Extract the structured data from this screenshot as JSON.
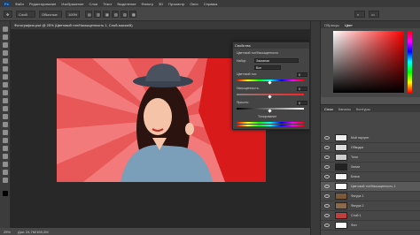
{
  "menubar": {
    "items": [
      "Файл",
      "Редактирование",
      "Изображение",
      "Слои",
      "Текст",
      "Выделение",
      "Фильтр",
      "3D",
      "Просмотр",
      "Окно",
      "Справка"
    ]
  },
  "options": {
    "select_label": "Слой",
    "mode_label": "Обычные",
    "mode_value": "100%"
  },
  "document": {
    "tab_title": "Фотография.psd @ 25% (Цветовой тон/Насыщенность 1, Слой-маска/8)",
    "zoom": "25%",
    "status": "Док: 24,7M/165,2M"
  },
  "dialog": {
    "title": "Свойства",
    "subtitle": "Цветовой тон/Насыщенность",
    "preset_label": "Набор:",
    "preset_value": "Заказная",
    "channel_value": "Все",
    "hue_label": "Цветовой тон:",
    "hue_value": "0",
    "sat_label": "Насыщенность:",
    "sat_value": "0",
    "light_label": "Яркость:",
    "light_value": "0",
    "tonirovanie": "Тонирование"
  },
  "color_panel": {
    "tabs": [
      "Образцы",
      "Цвет"
    ],
    "accent": "#ff0000"
  },
  "layers_panel": {
    "tabs": [
      "Слои",
      "Каналы",
      "Контуры"
    ],
    "layers": [
      {
        "name": "Мой портрет",
        "thumb": "#eeeeee"
      },
      {
        "name": "Обводка",
        "thumb": "#dddddd"
      },
      {
        "name": "Тени",
        "thumb": "#cccccc"
      },
      {
        "name": "Линии",
        "thumb": "#222222"
      },
      {
        "name": "Блики",
        "thumb": "#f5f5f5"
      },
      {
        "name": "Цветовой тон/Насыщенность 1",
        "thumb": "#ffffff"
      },
      {
        "name": "Фигура 1",
        "thumb": "#7a5a3a"
      },
      {
        "name": "Фигура 2",
        "thumb": "#8a6a4a"
      },
      {
        "name": "Слой 1",
        "thumb": "#c04040"
      },
      {
        "name": "Фон",
        "thumb": "#ffffff"
      }
    ]
  }
}
